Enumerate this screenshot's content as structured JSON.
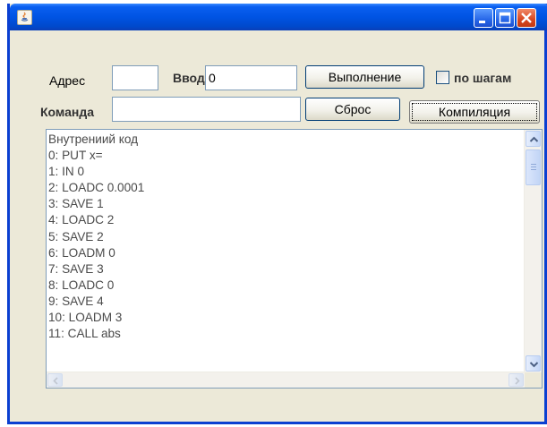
{
  "window": {
    "title": "",
    "controls": [
      "minimize-icon",
      "maximize-icon",
      "close-icon"
    ],
    "colors": {
      "titlebar": "#0054e3",
      "frame": "#ece9d8",
      "close": "#d9461f"
    }
  },
  "form": {
    "address": {
      "label": "Адрес",
      "value": ""
    },
    "input": {
      "label": "Ввод",
      "value": "0"
    },
    "command": {
      "label": "Команда",
      "value": ""
    },
    "execute_label": "Выполнение",
    "reset_label": "Сброс",
    "compile_label": "Компиляция",
    "step_mode": {
      "label": "по шагам",
      "checked": false
    }
  },
  "code": {
    "lines": [
      "Внутрениий код",
      "0: PUT x=",
      "1: IN 0",
      "2: LOADC 0.0001",
      "3: SAVE 1",
      "4: LOADC 2",
      "5: SAVE 2",
      "6: LOADM 0",
      "7: SAVE 3",
      "8: LOADC 0",
      "9: SAVE 4",
      "10: LOADM 3",
      "11: CALL abs"
    ]
  }
}
